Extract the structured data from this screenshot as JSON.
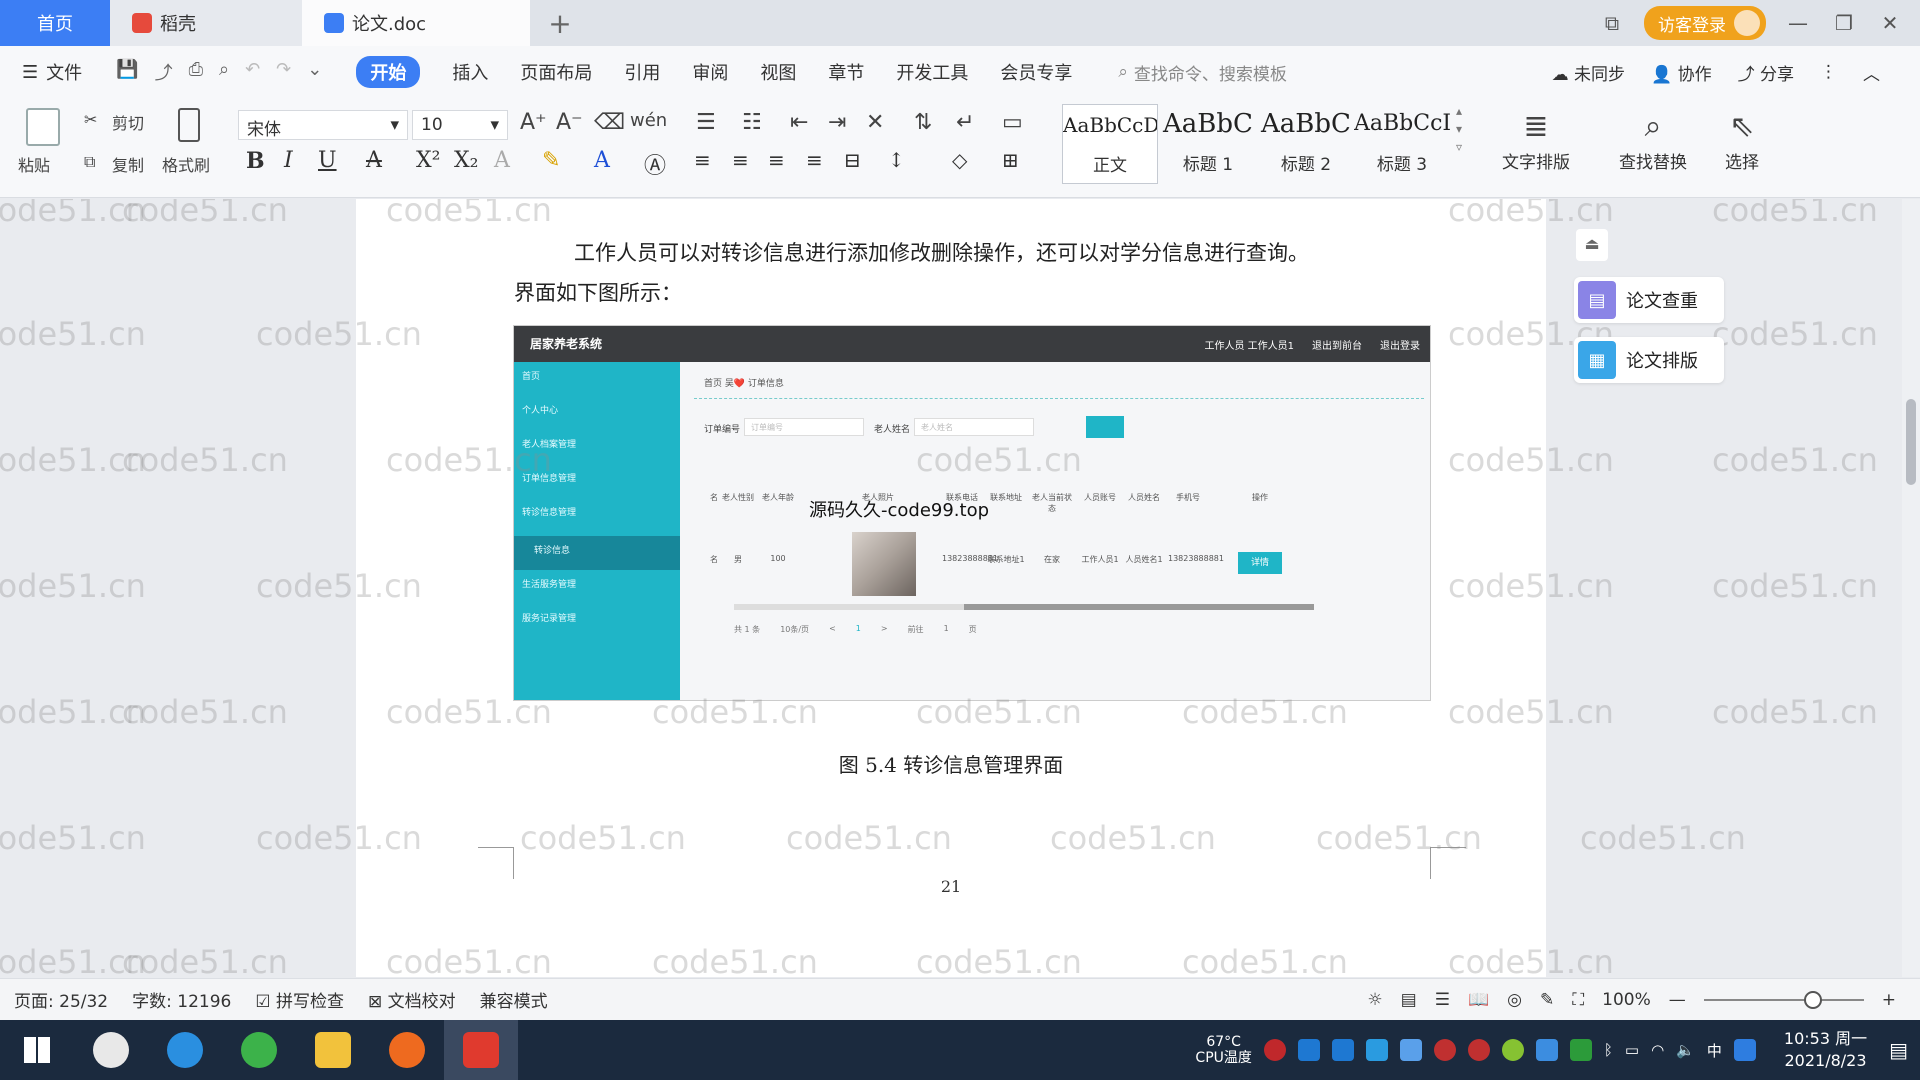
{
  "tabs": {
    "home": "首页",
    "daoke": "稻壳",
    "doc": "论文.doc",
    "add": "+"
  },
  "titlebar": {
    "login": "访客登录"
  },
  "menu": {
    "file": "文件",
    "items": [
      "开始",
      "插入",
      "页面布局",
      "引用",
      "审阅",
      "视图",
      "章节",
      "开发工具",
      "会员专享"
    ],
    "search_placeholder": "查找命令、搜索模板",
    "right": [
      "未同步",
      "协作",
      "分享"
    ]
  },
  "ribbon": {
    "cut": "剪切",
    "paste": "粘贴",
    "copy": "复制",
    "format_painter": "格式刷",
    "font_name": "宋体",
    "font_size": "10",
    "styles": [
      {
        "sample": "AaBbCcDc",
        "name": "正文"
      },
      {
        "sample": "AaBbC",
        "name": "标题 1"
      },
      {
        "sample": "AaBbC",
        "name": "标题 2"
      },
      {
        "sample": "AaBbCcI",
        "name": "标题 3"
      }
    ],
    "text_layout": "文字排版",
    "find_replace": "查找替换",
    "select": "选择"
  },
  "document": {
    "para1": "工作人员可以对转诊信息进行添加修改删除操作，还可以对学分信息进行查询。",
    "para2": "界面如下图所示：",
    "caption": "图 5.4  转诊信息管理界面",
    "page_number": "21",
    "overlay": "源码久久-code99.top"
  },
  "embedded": {
    "title": "居家养老系统",
    "top_links": [
      "工作人员 工作人员1",
      "退出到前台",
      "退出登录"
    ],
    "sidebar": [
      "首页",
      "个人中心",
      "老人档案管理",
      "订单信息管理",
      "转诊信息管理",
      "转诊信息",
      "生活服务管理",
      "服务记录管理"
    ],
    "breadcrumb": "首页  吴❤️  订单信息",
    "label_order": "订单编号",
    "label_name": "老人姓名",
    "ph_order": "订单编号",
    "ph_name": "老人姓名",
    "headers": [
      "名",
      "老人性别",
      "老人年龄",
      "老人照片",
      "联系电话",
      "联系地址",
      "老人当前状态",
      "人员账号",
      "人员姓名",
      "手机号",
      "操作"
    ],
    "row": [
      "名",
      "男",
      "100",
      "13823888881",
      "联系地址1",
      "在家",
      "工作人员1",
      "人员姓名1",
      "13823888881"
    ],
    "edit": "详情",
    "pager": [
      "共 1 条",
      "10条/页",
      "<",
      "1",
      ">",
      "前往",
      "1",
      "页"
    ]
  },
  "watermark": "code51.cn",
  "float": {
    "check": "论文查重",
    "layout": "论文排版"
  },
  "status": {
    "page": "页面: 25/32",
    "words": "字数: 12196",
    "spell": "拼写检查",
    "proof": "文档校对",
    "compat": "兼容模式",
    "zoom": "100%"
  },
  "taskbar": {
    "temp": "67°C",
    "cpu": "CPU温度",
    "ime": "中",
    "time": "10:53 周一",
    "date": "2021/8/23"
  },
  "colors": {
    "accent": "#3c7ef4",
    "embed_sidebar": "#1fb5c7",
    "login": "#f0a21c"
  }
}
